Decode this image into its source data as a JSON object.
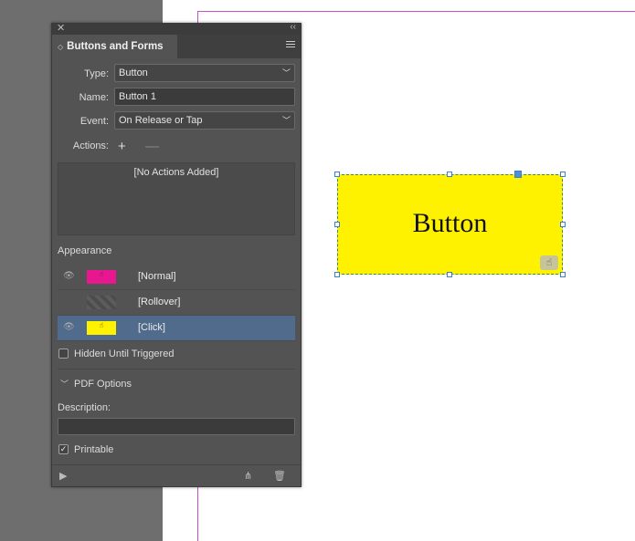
{
  "panel": {
    "title": "Buttons and Forms",
    "type_label": "Type:",
    "type_value": "Button",
    "name_label": "Name:",
    "name_value": "Button 1",
    "event_label": "Event:",
    "event_value": "On Release or Tap",
    "actions_label": "Actions:",
    "actions_empty": "[No Actions Added]",
    "appearance_title": "Appearance",
    "states": [
      {
        "label": "[Normal]",
        "swatch": "pink",
        "visible": true,
        "selected": false
      },
      {
        "label": "[Rollover]",
        "swatch": "empty",
        "visible": false,
        "selected": false
      },
      {
        "label": "[Click]",
        "swatch": "yellow",
        "visible": true,
        "selected": true
      }
    ],
    "hidden_until_triggered": "Hidden Until Triggered",
    "hidden_checked": false,
    "pdf_options": "PDF Options",
    "description_label": "Description:",
    "description_value": "",
    "printable": "Printable",
    "printable_checked": true
  },
  "canvas": {
    "button_text": "Button",
    "button_color": "#fff200"
  },
  "colors": {
    "accent_selected": "#516b8d",
    "normal_swatch": "#e8178f",
    "margin_guide": "#c94fc9"
  },
  "icons": {
    "close": "close-icon",
    "collapse": "collapse-icon",
    "menu": "hamburger-menu-icon",
    "add": "plus-icon",
    "remove": "minus-icon",
    "eye": "eye-icon",
    "preview": "preview-icon",
    "convert": "convert-button-icon",
    "delete": "trash-icon"
  }
}
